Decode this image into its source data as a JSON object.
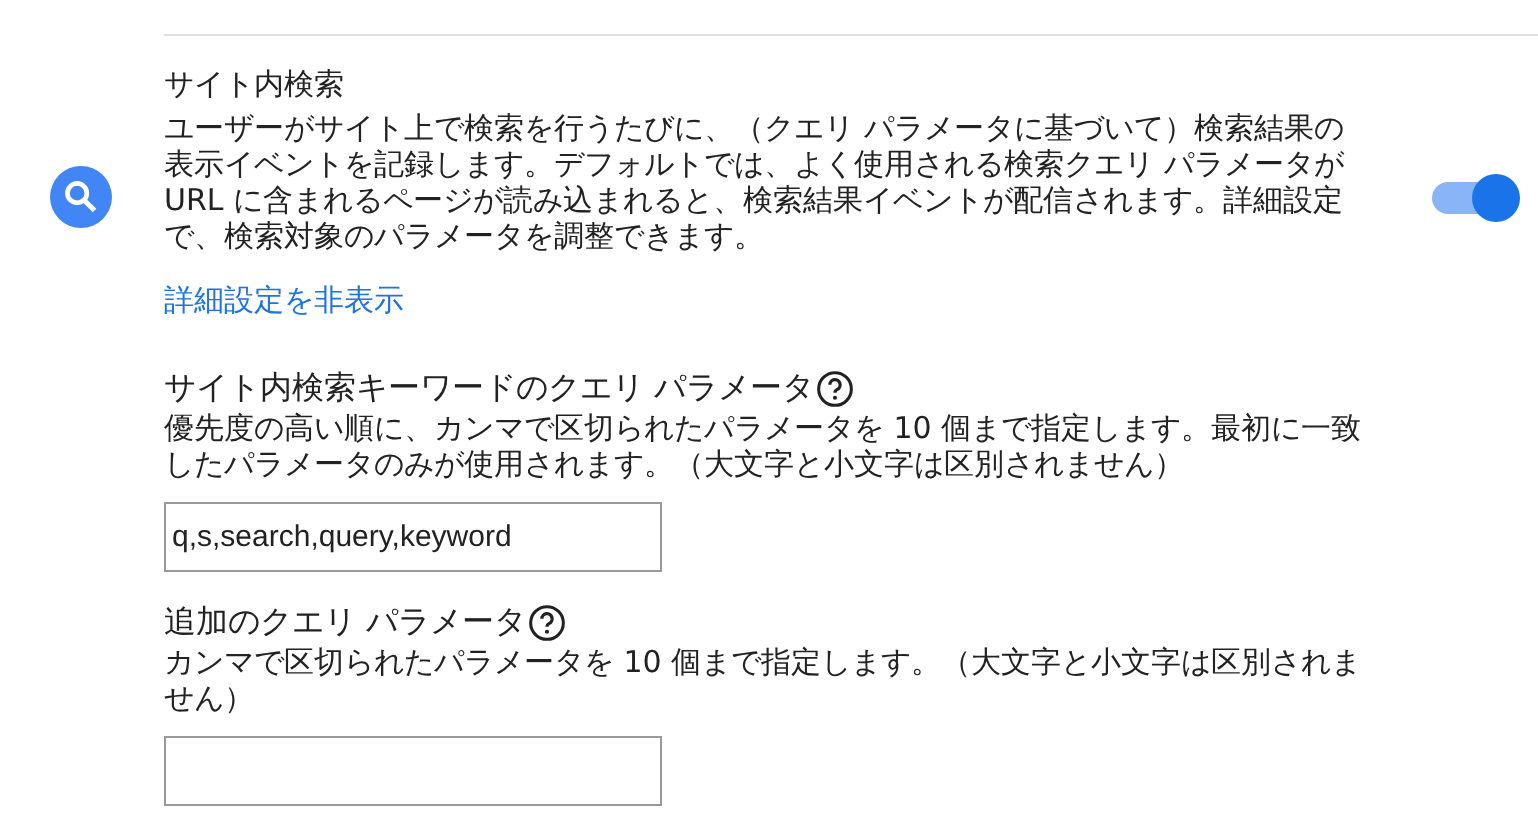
{
  "setting": {
    "title": "サイト内検索",
    "description": "ユーザーがサイト上で検索を行うたびに、（クエリ パラメータに基づいて）検索結果の表示イベントを記録します。デフォルトでは、よく使用される検索クエリ パラメータが URL に含まれるページが読み込まれると、検索結果イベントが配信されます。詳細設定で、検索対象のパラメータを調整できます。",
    "enabled": true,
    "link": "詳細設定を非表示"
  },
  "fields": [
    {
      "label": "サイト内検索キーワードのクエリ パラメータ",
      "hint": "優先度の高い順に、カンマで区切られたパラメータを 10 個まで指定します。最初に一致したパラメータのみが使用されます。（大文字と小文字は区別されません）",
      "input": {
        "value": "q,s,search,query,keyword"
      }
    },
    {
      "label": "追加のクエリ パラメータ",
      "hint": "カンマで区切られたパラメータを 10 個まで指定します。（大文字と小文字は区別されません）"
    }
  ]
}
